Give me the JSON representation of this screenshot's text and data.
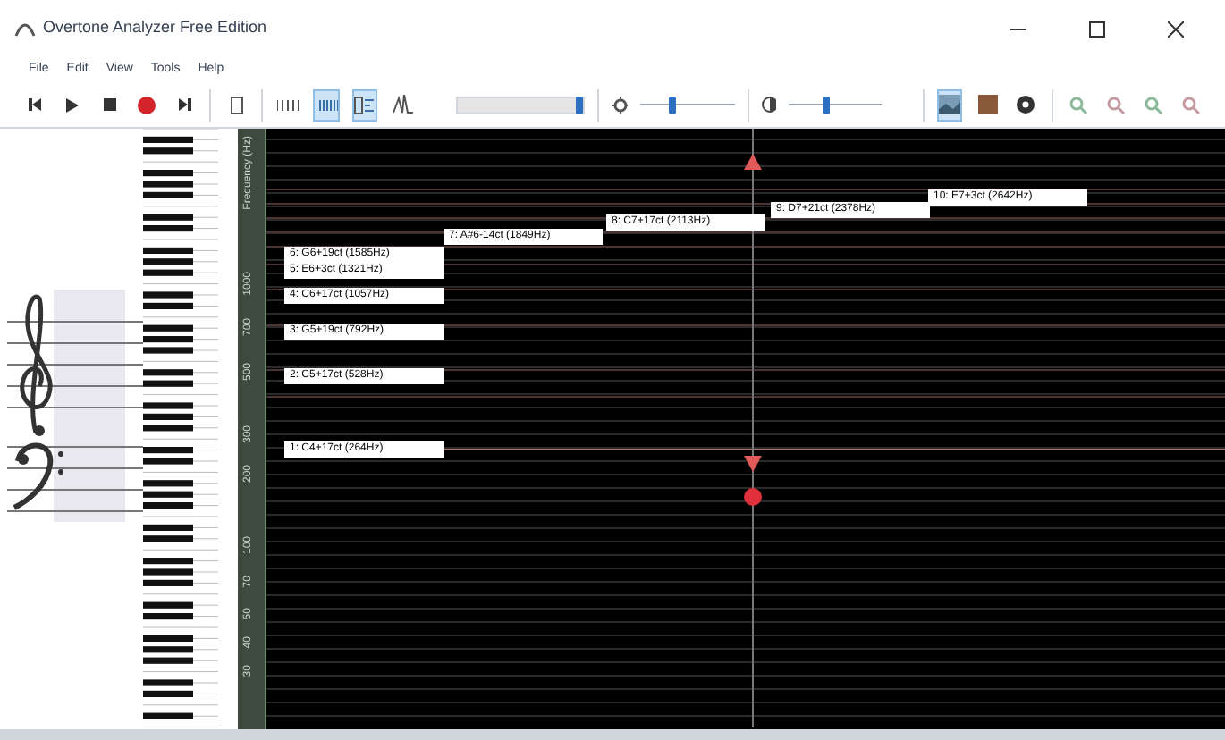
{
  "window": {
    "title": "Overtone Analyzer Free Edition"
  },
  "menu": [
    "File",
    "Edit",
    "View",
    "Tools",
    "Help"
  ],
  "toolbar": {
    "toggles": [
      {
        "kind": "grid8",
        "selected": false
      },
      {
        "kind": "grid16",
        "selected": true
      },
      {
        "kind": "roll",
        "selected": true
      },
      {
        "kind": "spectrum",
        "selected": false
      },
      {
        "kind": "image",
        "selected": true
      },
      {
        "kind": "palette",
        "selected": false
      }
    ],
    "sliders": [
      {
        "kind": "volume",
        "level": 0.95
      },
      {
        "kind": "brightness",
        "level": 0.35
      },
      {
        "kind": "contrast",
        "level": 0.4
      }
    ]
  },
  "axis": {
    "title": "Frequency (Hz)",
    "ticks": [
      "1000",
      "700",
      "500",
      "300",
      "200",
      "100",
      "70",
      "50",
      "40",
      "30"
    ]
  },
  "overtones": [
    {
      "label": "10: E7+3ct (2642Hz)"
    },
    {
      "label": "9: D7+21ct (2378Hz)"
    },
    {
      "label": "8: C7+17ct (2113Hz)"
    },
    {
      "label": "7: A#6-14ct (1849Hz)"
    },
    {
      "label": "6: G6+19ct (1585Hz)"
    },
    {
      "label": "5: E6+3ct (1321Hz)"
    },
    {
      "label": "4: C6+17ct (1057Hz)"
    },
    {
      "label": "3: G5+19ct (792Hz)"
    },
    {
      "label": "2: C5+17ct (528Hz)"
    },
    {
      "label": "1: C4+17ct (264Hz)"
    }
  ]
}
